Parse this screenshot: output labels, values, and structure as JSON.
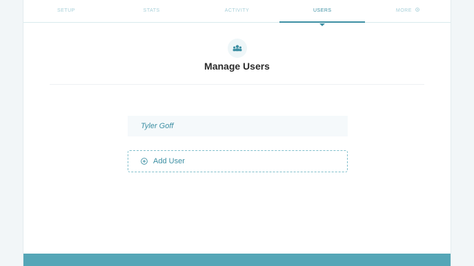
{
  "tabs": [
    {
      "label": "SETUP"
    },
    {
      "label": "STATS"
    },
    {
      "label": "ACTIVITY"
    },
    {
      "label": "USERS"
    },
    {
      "label": "MORE"
    }
  ],
  "header": {
    "icon": "users-icon",
    "title": "Manage Users"
  },
  "users": [
    {
      "name": "Tyler Goff"
    }
  ],
  "add_user": {
    "label": "Add User",
    "icon": "plus-circle-icon"
  },
  "colors": {
    "accent": "#3c8fa3",
    "footer": "#55a6b7"
  }
}
